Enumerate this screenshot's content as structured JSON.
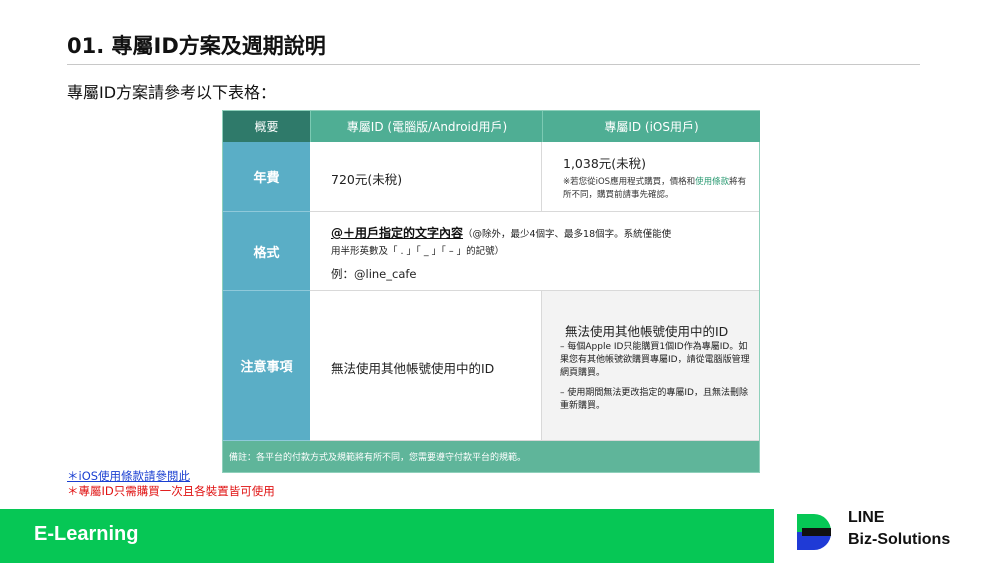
{
  "slide": {
    "title": "01. 專屬ID方案及週期說明",
    "intro": "專屬ID方案請參考以下表格："
  },
  "table": {
    "headers": [
      "概要",
      "專屬ID (電腦版/Android用戶)",
      "專屬ID (iOS用戶)"
    ],
    "rows": {
      "fee": {
        "label": "年費",
        "desktop": "720元(未稅)",
        "ios_price": "1,038元(未稅)",
        "ios_note_a": "※若您從iOS應用程式購買，價格和",
        "ios_note_link": "使用條款",
        "ios_note_b": "將有所不同，購買前請事先確認。"
      },
      "format": {
        "label": "格式",
        "rule_bold": "@＋用戶指定的文字內容",
        "rule_rest": "（@除外，最少4個字、最多18個字。系統僅能使",
        "rule_line2": "用半形英數及「 . 」「 _ 」「 – 」的記號）",
        "example": "例：@line_cafe"
      },
      "notes": {
        "label": "注意事項",
        "desktop": "無法使用其他帳號使用中的ID",
        "ios_title": "無法使用其他帳號使用中的ID",
        "ios_bullet1": "– 每個Apple ID只能購買1個ID作為專屬ID。如果您有其他帳號欲購買專屬ID，請從電腦版管理網頁購買。",
        "ios_bullet2": "– 使用期間無法更改指定的專屬ID，且無法刪除重新購買。"
      }
    },
    "footnote": "備註：各平台的付款方式及規範將有所不同，您需要遵守付款平台的規範。"
  },
  "links": {
    "ios_terms": "＊iOS使用條款請參閱此",
    "once_note": "＊專屬ID只需購買一次且各裝置皆可使用"
  },
  "footer": {
    "label": "E-Learning",
    "brand_line1": "LINE",
    "brand_line2": "Biz-Solutions"
  },
  "colors": {
    "green": "#06c755",
    "header_dark": "#2f7a6a",
    "header": "#4fae94",
    "row_label": "#5aaec6",
    "link_blue": "#1a3fd1",
    "note_red": "#e01212"
  }
}
